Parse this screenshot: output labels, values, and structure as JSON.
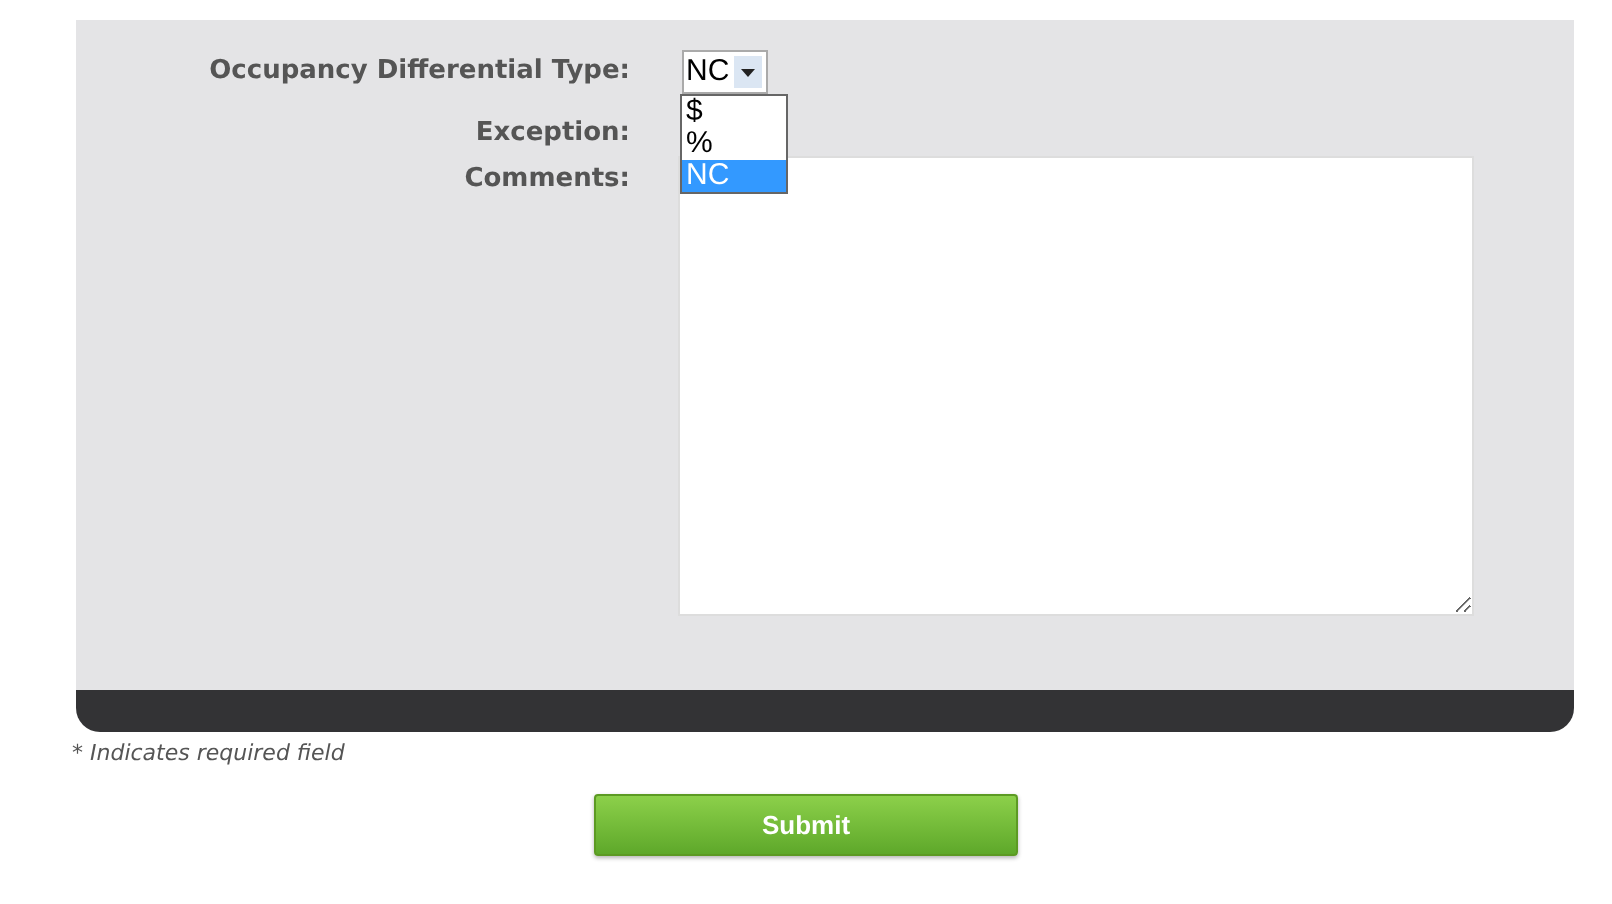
{
  "form": {
    "fields": [
      {
        "kind": "select",
        "label": "Occupancy Differential Type:",
        "value": "NC",
        "expanded": true,
        "options": [
          {
            "label": "$",
            "selected": false
          },
          {
            "label": "%",
            "selected": false
          },
          {
            "label": "NC",
            "selected": true
          }
        ]
      },
      {
        "kind": "blank",
        "label": "Exception:"
      },
      {
        "kind": "textarea",
        "label": "Comments:"
      }
    ]
  },
  "footnote": "* Indicates required field",
  "submit": "Submit"
}
